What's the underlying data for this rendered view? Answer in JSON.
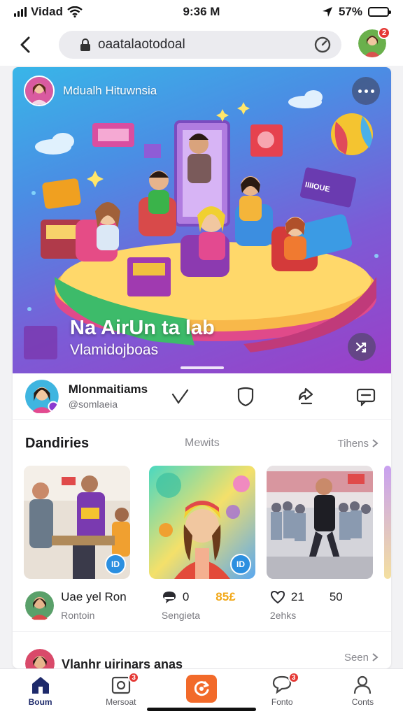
{
  "status_bar": {
    "carrier": "Vidad",
    "time": "9:36 M",
    "battery": "57%",
    "battery_level": 0.57
  },
  "top_nav": {
    "url": "oaatalaotodoal",
    "notification_count": "2"
  },
  "hero": {
    "author_name": "Mdualh Hituwnsia",
    "title": "Na AirUn ta lab",
    "subtitle": "Vlamidojboas"
  },
  "post_bar": {
    "user_name": "Mlonmaitiams",
    "user_handle": "@somlaeia"
  },
  "section": {
    "title": "Dandiries",
    "tab": "Mewits",
    "more": "Tihens"
  },
  "thumbs": [
    {
      "badge": ""
    },
    {
      "badge": ""
    },
    {
      "badge": ""
    }
  ],
  "thumb_badges": [
    "ID",
    "ID"
  ],
  "stats": {
    "name": "Uae yel Ron",
    "sub": "Rontoin",
    "comments_count": "0",
    "comments_label": "Sengieta",
    "accent_value": "85£",
    "likes_count": "21",
    "likes_label": "2ehks",
    "shares_count": "50"
  },
  "next_item": {
    "title": "Vlanhr uirinars anas",
    "see": "Seen"
  },
  "tab_bar": {
    "home": "Boum",
    "messages": "Mersoat",
    "messages_badge": "3",
    "chat": "Fonto",
    "chat_badge": "3",
    "profile": "Conts"
  },
  "colors": {
    "accent_orange": "#f26a2a",
    "badge_red": "#e53935",
    "badge_blue": "#2b8fe0",
    "nav_active": "#1e2a6b"
  }
}
